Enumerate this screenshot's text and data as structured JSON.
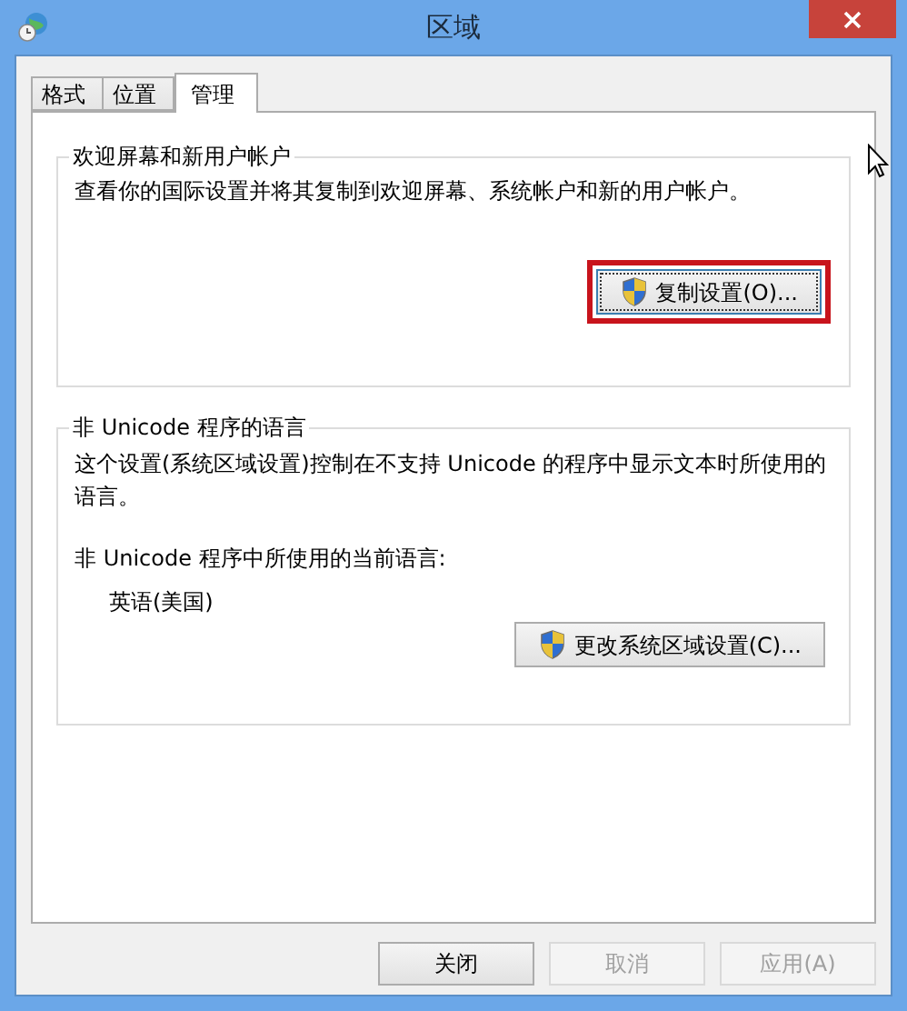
{
  "window": {
    "title": "区域"
  },
  "tabs": [
    {
      "label": "格式",
      "selected": false
    },
    {
      "label": "位置",
      "selected": false
    },
    {
      "label": "管理",
      "selected": true
    }
  ],
  "welcome_group": {
    "title": "欢迎屏幕和新用户帐户",
    "description": "查看你的国际设置并将其复制到欢迎屏幕、系统帐户和新的用户帐户。",
    "button": {
      "label": "复制设置(O)...",
      "highlighted": true
    }
  },
  "unicode_group": {
    "title": "非 Unicode 程序的语言",
    "description": "这个设置(系统区域设置)控制在不支持 Unicode 的程序中显示文本时所使用的语言。",
    "current_label": "非 Unicode 程序中所使用的当前语言:",
    "current_value": "英语(美国)",
    "button": {
      "label": "更改系统区域设置(C)...",
      "highlighted": false
    }
  },
  "buttons": [
    {
      "label": "关闭",
      "disabled": false
    },
    {
      "label": "取消",
      "disabled": true
    },
    {
      "label": "应用(A)",
      "disabled": true
    }
  ]
}
